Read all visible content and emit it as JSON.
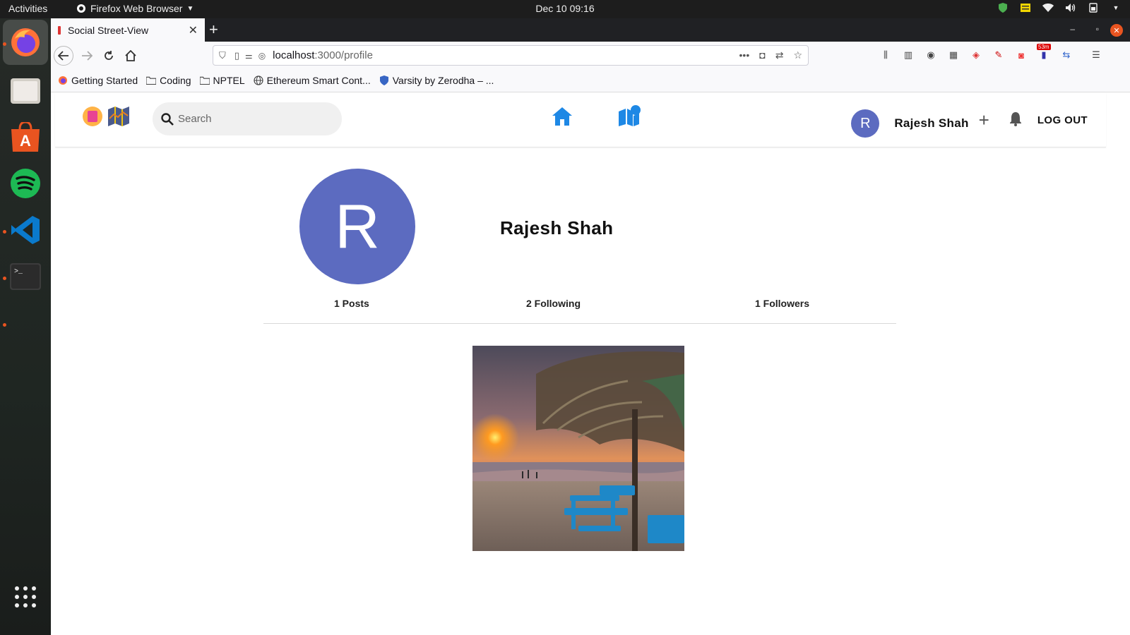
{
  "system_bar": {
    "activities": "Activities",
    "app_name": "Firefox Web Browser",
    "clock": "Dec 10  09:16"
  },
  "browser": {
    "tab_title": "Social Street-View",
    "url_host": "localhost",
    "url_path": ":3000/profile",
    "extension_badge": "53m",
    "bookmarks": [
      {
        "label": "Getting Started",
        "icon": "firefox-icon"
      },
      {
        "label": "Coding",
        "icon": "folder-icon"
      },
      {
        "label": "NPTEL",
        "icon": "folder-icon"
      },
      {
        "label": "Ethereum Smart Cont...",
        "icon": "globe-icon"
      },
      {
        "label": "Varsity by Zerodha – ...",
        "icon": "shield-icon"
      }
    ]
  },
  "app": {
    "search_placeholder": "Search",
    "user_initial": "R",
    "user_name": "Rajesh Shah",
    "logout_label": "LOG OUT"
  },
  "profile": {
    "initial": "R",
    "name": "Rajesh Shah",
    "posts": "1 Posts",
    "following": "2 Following",
    "followers": "1 Followers"
  },
  "colors": {
    "avatar": "#5c6bc0",
    "nav_icon": "#1e88e5"
  }
}
